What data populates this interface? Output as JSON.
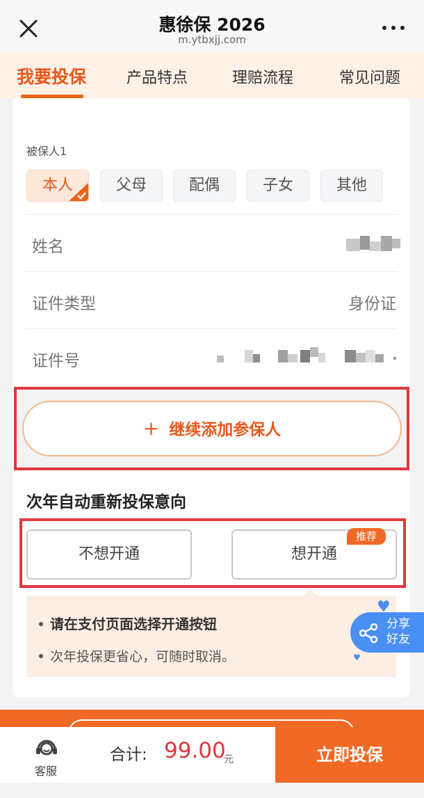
{
  "header": {
    "title": "惠徐保 2026",
    "url": "m.ytbxjj.com",
    "close_icon": "close-icon",
    "more_icon": "more-dots-icon"
  },
  "tabs": [
    {
      "label": "我要投保",
      "active": true
    },
    {
      "label": "产品特点",
      "active": false
    },
    {
      "label": "理赔流程",
      "active": false
    },
    {
      "label": "常见问题",
      "active": false
    }
  ],
  "insured": {
    "section_label": "被保人1",
    "relations": [
      "本人",
      "父母",
      "配偶",
      "子女",
      "其他"
    ],
    "selected_relation": "本人",
    "name_label": "姓名",
    "id_type_label": "证件类型",
    "id_type_value": "身份证",
    "id_no_label": "证件号"
  },
  "add_insured": {
    "label": "继续添加参保人",
    "icon": "plus-icon"
  },
  "renewal": {
    "title": "次年自动重新投保意向",
    "option_no": "不想开通",
    "option_yes": "想开通",
    "badge": "推荐",
    "notice_1": "请在支付页面选择开通按钮",
    "notice_2": "次年投保更省心，可随时取消。"
  },
  "share": {
    "line1": "分享",
    "line2": "好友",
    "icon": "share-icon"
  },
  "footer": {
    "service_label": "客服",
    "service_icon": "headset-icon",
    "total_label": "合计:",
    "total_value": "99.00",
    "total_unit": "元",
    "buy_label": "立即投保"
  },
  "colors": {
    "accent": "#F06A26",
    "highlight_border": "#E2373F",
    "price": "#E2373F",
    "tab_bg": "#FEF1E6"
  }
}
